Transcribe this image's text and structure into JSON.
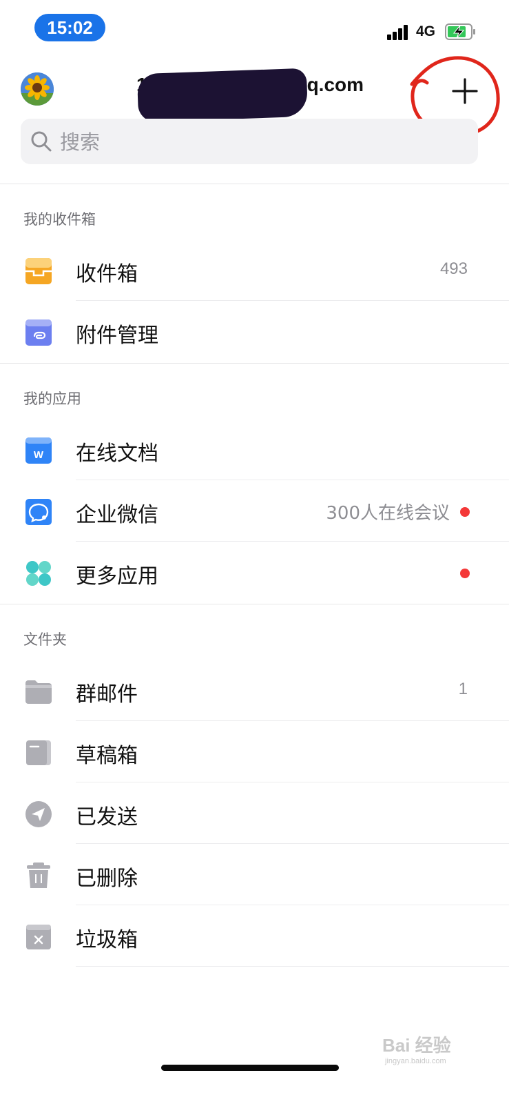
{
  "status_bar": {
    "time": "15:02",
    "network": "4G"
  },
  "header": {
    "account_visible": "1",
    "account_suffix": "q.com",
    "add_icon": "plus-icon",
    "avatar_icon": "sunflower-avatar"
  },
  "search": {
    "placeholder": "搜索",
    "icon": "search-icon"
  },
  "sections": {
    "inbox": {
      "title": "我的收件箱",
      "items": [
        {
          "label": "收件箱",
          "count": "493",
          "icon": "inbox-icon",
          "color": "#f5a623"
        },
        {
          "label": "附件管理",
          "icon": "attachment-icon",
          "color": "#6c7ff0"
        }
      ]
    },
    "apps": {
      "title": "我的应用",
      "items": [
        {
          "label": "在线文档",
          "icon": "doc-icon",
          "color": "#2f84f7"
        },
        {
          "label": "企业微信",
          "extra": "300人在线会议",
          "badge": true,
          "icon": "wecom-icon",
          "color": "#2f84f7"
        },
        {
          "label": "更多应用",
          "badge": true,
          "icon": "more-apps-icon",
          "color": "#3ec7c7"
        }
      ]
    },
    "folders": {
      "title": "文件夹",
      "items": [
        {
          "label": "群邮件",
          "count": "1",
          "icon": "folder-icon"
        },
        {
          "label": "草稿箱",
          "icon": "draft-icon"
        },
        {
          "label": "已发送",
          "icon": "sent-icon"
        },
        {
          "label": "已删除",
          "icon": "trash-icon"
        },
        {
          "label": "垃圾箱",
          "icon": "spam-icon"
        }
      ]
    }
  },
  "watermark": {
    "brand": "Bai  经验",
    "url": "jingyan.baidu.com"
  },
  "colors": {
    "accent": "#1a73e8",
    "badge": "#f43838",
    "annotation": "#e0261b",
    "folder_gray": "#aeaeb4"
  }
}
